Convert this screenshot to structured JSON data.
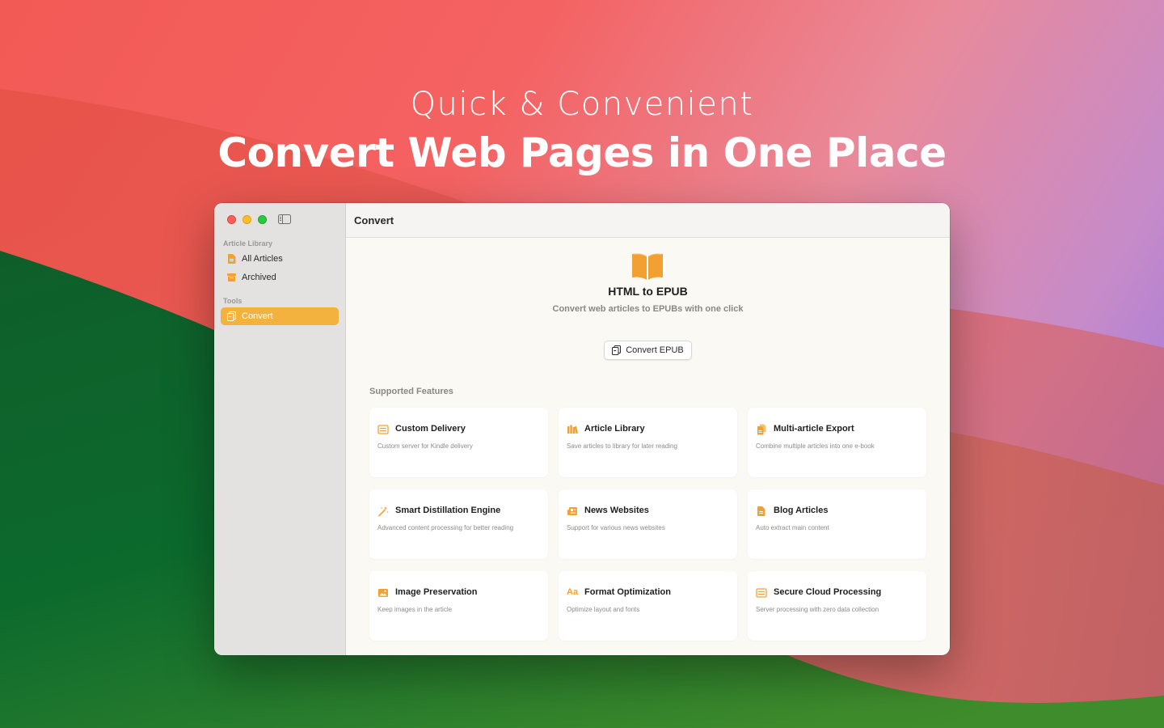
{
  "headline": {
    "subtitle": "Quick & Convenient",
    "title": "Convert Web Pages in One Place"
  },
  "sidebar": {
    "sections": [
      {
        "label": "Article Library",
        "items": [
          {
            "label": "All Articles",
            "icon": "document-icon"
          },
          {
            "label": "Archived",
            "icon": "archive-box-icon"
          }
        ]
      },
      {
        "label": "Tools",
        "items": [
          {
            "label": "Convert",
            "icon": "convert-copy-icon",
            "selected": true
          }
        ]
      }
    ]
  },
  "toolbar": {
    "title": "Convert"
  },
  "hero": {
    "icon": "open-book-icon",
    "title": "HTML to EPUB",
    "subtitle": "Convert web articles to EPUBs with one click",
    "button_label": "Convert EPUB"
  },
  "features": {
    "label": "Supported Features",
    "items": [
      {
        "title": "Custom Delivery",
        "desc": "Custom server for Kindle delivery",
        "icon": "list-icon"
      },
      {
        "title": "Article Library",
        "desc": "Save articles to library for later reading",
        "icon": "books-icon"
      },
      {
        "title": "Multi-article Export",
        "desc": "Combine multiple articles into one e-book",
        "icon": "documents-icon"
      },
      {
        "title": "Smart Distillation Engine",
        "desc": "Advanced content processing for better reading",
        "icon": "magic-wand-icon"
      },
      {
        "title": "News Websites",
        "desc": "Support for various news websites",
        "icon": "newspaper-icon"
      },
      {
        "title": "Blog Articles",
        "desc": "Auto extract main content",
        "icon": "document-icon"
      },
      {
        "title": "Image Preservation",
        "desc": "Keep images in the article",
        "icon": "photo-icon"
      },
      {
        "title": "Format Optimization",
        "desc": "Optimize layout and fonts",
        "icon": "text-format-icon",
        "glyph": "Aa"
      },
      {
        "title": "Secure Cloud Processing",
        "desc": "Server processing with zero data collection",
        "icon": "list-icon"
      }
    ]
  },
  "colors": {
    "accent": "#f3a033",
    "sidebar_selected": "#f3b13d",
    "wallpaper_red": "#f25a55",
    "wallpaper_green": "#0d6a2c",
    "wallpaper_purple": "#8f6fe6"
  }
}
